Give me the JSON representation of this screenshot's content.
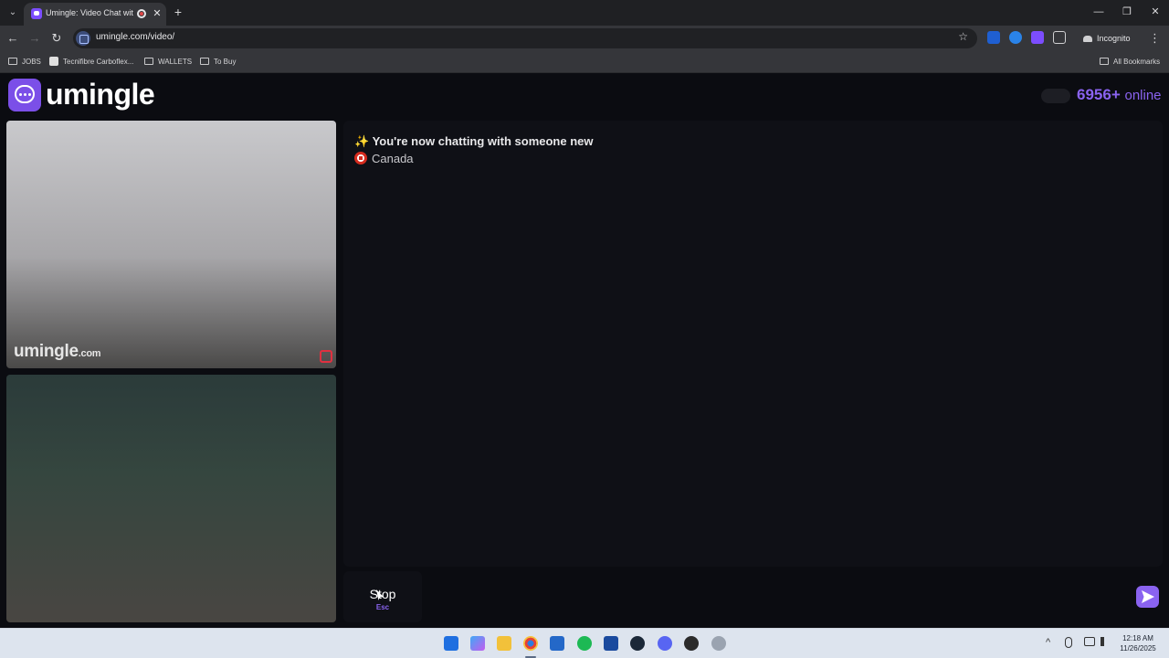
{
  "browser": {
    "tab_title": "Umingle: Video Chat with S",
    "tab_close": "✕",
    "new_tab": "+",
    "url": "umingle.com/video/",
    "incognito_label": "Incognito",
    "window_controls": {
      "minimize": "—",
      "restore": "❐",
      "close": "✕"
    },
    "nav": {
      "back": "←",
      "forward": "→",
      "reload": "↻"
    },
    "star": "☆",
    "menu": "⋮",
    "bookmarks": [
      {
        "label": "JOBS",
        "icon": "folder-icon"
      },
      {
        "label": "Tecnifibre Carboflex...",
        "icon": "tecnifibre-icon"
      },
      {
        "label": "WALLETS",
        "icon": "folder-icon"
      },
      {
        "label": "To Buy",
        "icon": "folder-icon"
      }
    ],
    "all_bookmarks": "All Bookmarks"
  },
  "site": {
    "logo_text": "umingle",
    "online_count": "6956+",
    "online_label": "online",
    "brand_color": "#8a63f0"
  },
  "video": {
    "watermark": "umingle",
    "watermark_suffix": ".com"
  },
  "chat": {
    "system_message_icon": "✨",
    "system_message": "You're now chatting with someone new",
    "country": "Canada"
  },
  "controls": {
    "stop_label": "Stop",
    "stop_shortcut": "Esc",
    "message_placeholder": ""
  },
  "taskbar": {
    "time": "12:18 AM",
    "date": "11/26/2025",
    "tray_chevron": "^"
  }
}
